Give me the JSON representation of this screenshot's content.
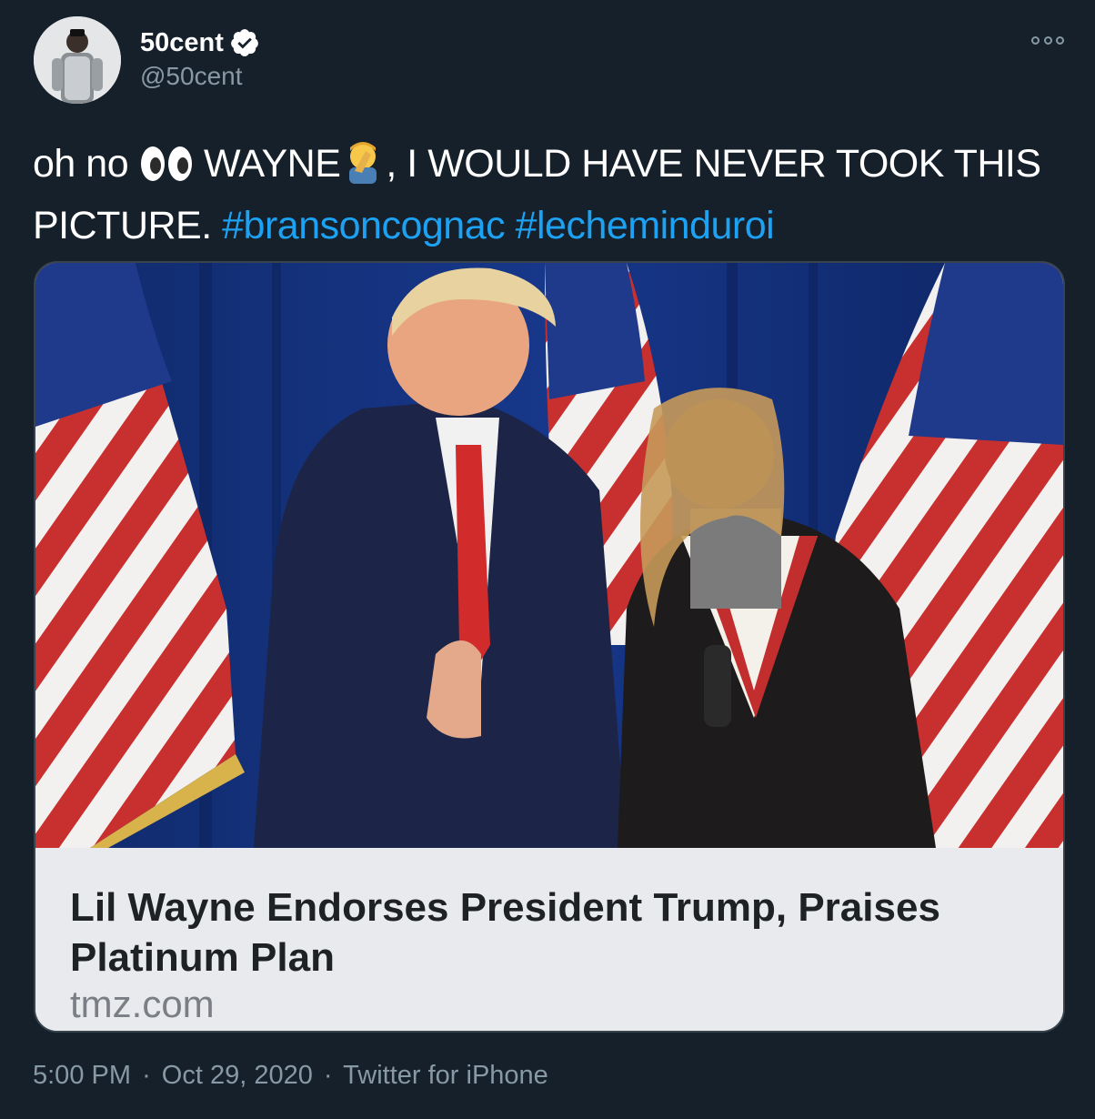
{
  "author": {
    "display_name": "50cent",
    "handle": "@50cent",
    "verified_icon": "verified-badge-icon"
  },
  "tweet": {
    "text_parts": {
      "p1": "oh no ",
      "p2": " WAYNE",
      "p3": ", I WOULD HAVE NEVER TOOK THIS PICTURE. ",
      "hashtag1": "#bransoncognac",
      "space": " ",
      "hashtag2": "#lecheminduroi"
    },
    "emojis": [
      "eyes-emoji",
      "facepalm-emoji"
    ]
  },
  "card": {
    "title": "Lil Wayne Endorses President Trump, Praises Platinum Plan",
    "domain": "tmz.com"
  },
  "meta": {
    "time": "5:00 PM",
    "sep1": "·",
    "date": "Oct 29, 2020",
    "sep2": "·",
    "source": "Twitter for iPhone"
  },
  "colors": {
    "background": "#15202b",
    "hashtag": "#1da1f2",
    "secondary_text": "#8899a6",
    "card_caption_bg": "#e9eaee"
  }
}
